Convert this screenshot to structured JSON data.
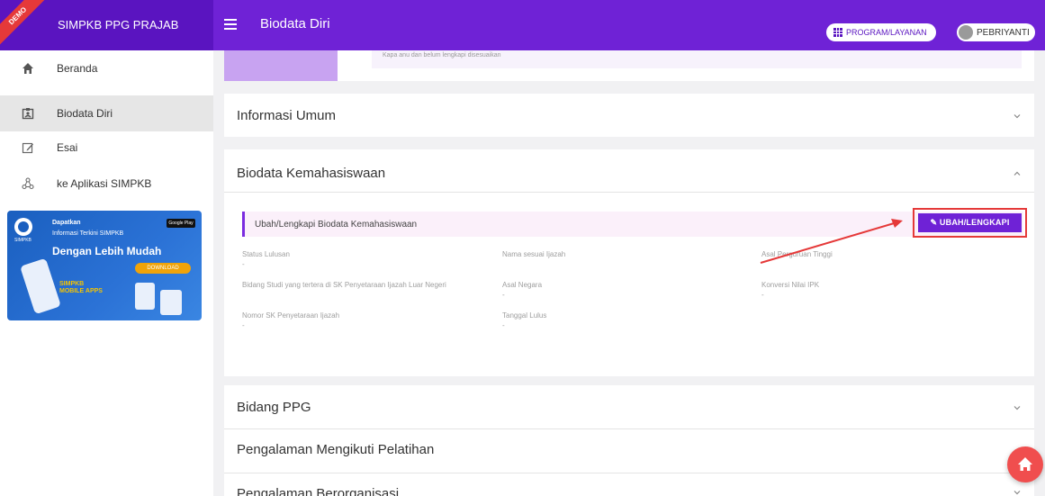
{
  "header": {
    "brand": "SIMPKB PPG PRAJAB",
    "ribbon": "DEMO",
    "page_title": "Biodata Diri",
    "program_button": "PROGRAM/LAYANAN",
    "user_name": "PEBRIYANTI"
  },
  "sidebar": {
    "items": [
      {
        "label": "Beranda",
        "icon": "home-icon"
      },
      {
        "label": "Biodata Diri",
        "icon": "id-card-icon"
      },
      {
        "label": "Esai",
        "icon": "edit-icon"
      },
      {
        "label": "ke Aplikasi SIMPKB",
        "icon": "network-icon"
      }
    ],
    "banner": {
      "line1": "Dapatkan",
      "line2": "Informasi Terkini SIMPKB",
      "headline": "Dengan Lebih Mudah",
      "download": "DOWNLOAD",
      "store": "Google Play",
      "app_line1": "SIMPKB",
      "app_line2": "MOBILE APPS",
      "logo_caption": "SIMPKB"
    }
  },
  "main": {
    "top_note": "Kapa anu dan belum lengkapi disesuaikan",
    "panels": {
      "info_umum": "Informasi Umum",
      "kemahasiswaan": "Biodata Kemahasiswaan",
      "bidang_ppg": "Bidang PPG",
      "pelatihan": "Pengalaman Mengikuti Pelatihan",
      "organisasi": "Pengalaman Berorganisasi"
    },
    "kemahasiswaan": {
      "note": "Ubah/Lengkapi Biodata Kemahasiswaan",
      "edit_button": "UBAH/LENGKAPI",
      "fields": [
        {
          "label": "Status Lulusan",
          "value": "-"
        },
        {
          "label": "Nama sesuai Ijazah",
          "value": ""
        },
        {
          "label": "Asal Perguruan Tinggi",
          "value": ""
        },
        {
          "label": "Bidang Studi yang tertera di SK Penyetaraan Ijazah Luar Negeri",
          "value": ""
        },
        {
          "label": "Asal Negara",
          "value": "-"
        },
        {
          "label": "Konversi Nilai IPK",
          "value": "-"
        },
        {
          "label": "Nomor SK Penyetaraan Ijazah",
          "value": "-"
        },
        {
          "label": "Tanggal Lulus",
          "value": "-"
        }
      ]
    }
  },
  "colors": {
    "header": "#6f22d6",
    "brand": "#5a14c0",
    "accent_red": "#e53939",
    "fab": "#f04e4e"
  }
}
